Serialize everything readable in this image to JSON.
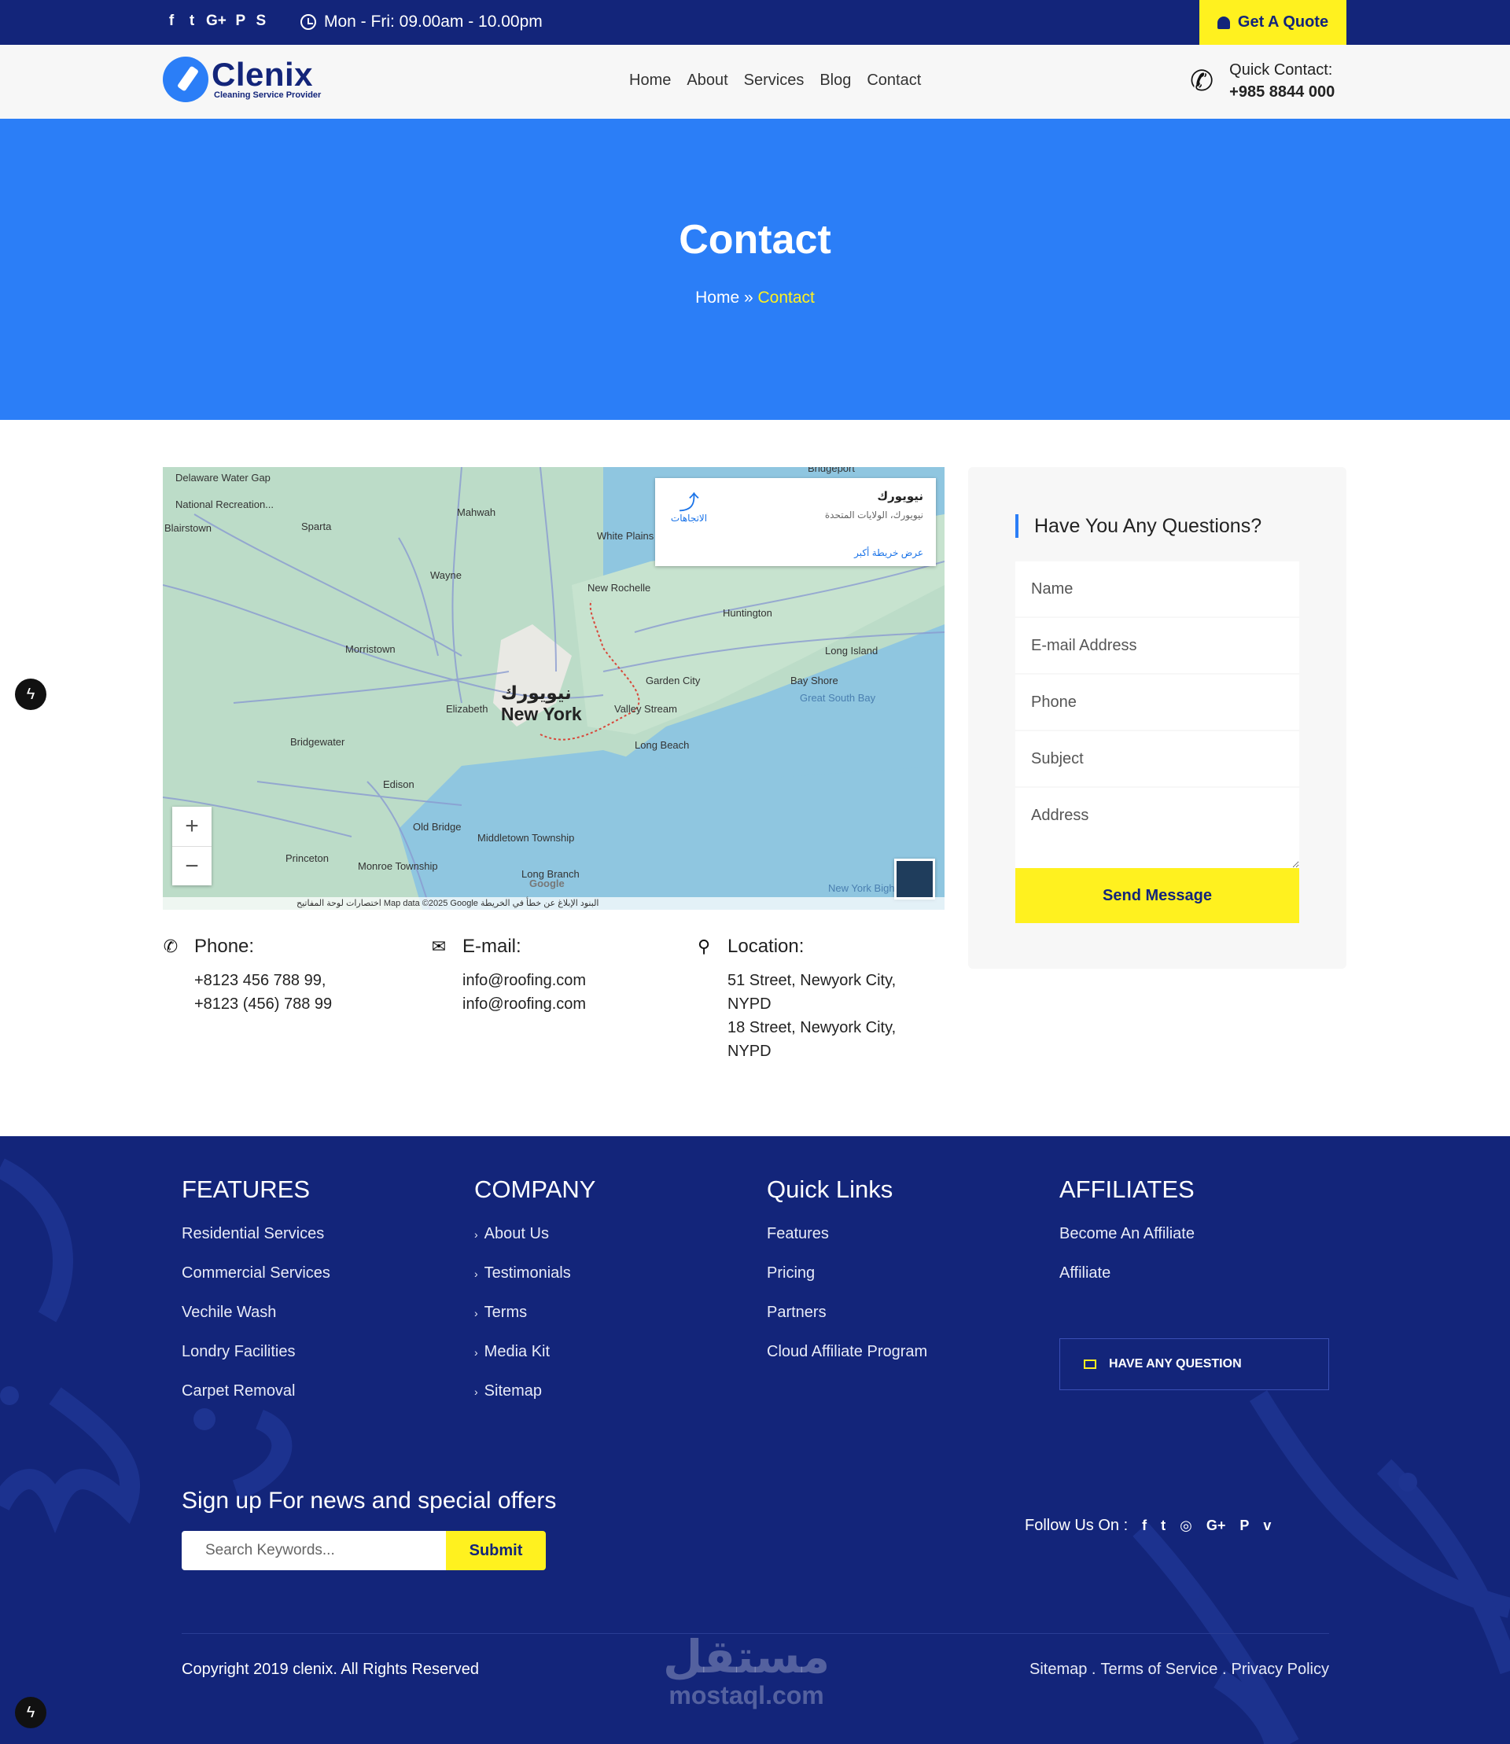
{
  "topbar": {
    "social": [
      "f",
      "t",
      "G+",
      "P",
      "S"
    ],
    "hours": "Mon - Fri: 09.00am - 10.00pm",
    "quote_label": "Get A Quote"
  },
  "header": {
    "logo_name": "Clenix",
    "logo_tagline": "Cleaning Service Provider",
    "nav": [
      "Home",
      "About",
      "Services",
      "Blog",
      "Contact"
    ],
    "quick_contact_label": "Quick Contact:",
    "quick_contact_number": "+985 8844 000"
  },
  "hero": {
    "title": "Contact",
    "breadcrumb_home": "Home",
    "breadcrumb_sep": "»",
    "breadcrumb_current": "Contact"
  },
  "map": {
    "card_title": "نيويورك",
    "card_subtitle": "نيويورك، الولايات المتحدة",
    "card_link": "عرض خريطة أكبر",
    "directions": "الاتجاهات",
    "city_ar": "نيويورك",
    "city_en": "New York",
    "footer_text": "اختصارات لوحة المفاتيح   Map data ©2025 Google   البنود   الإبلاغ عن خطأ في الخريطة",
    "labels": [
      {
        "text": "Delaware Water Gap"
      },
      {
        "text": "National Recreation..."
      },
      {
        "text": "Blairstown"
      },
      {
        "text": "Sparta"
      },
      {
        "text": "Mahwah"
      },
      {
        "text": "Wayne"
      },
      {
        "text": "White Plains"
      },
      {
        "text": "New Rochelle"
      },
      {
        "text": "Huntington"
      },
      {
        "text": "Morristown"
      },
      {
        "text": "Elizabeth"
      },
      {
        "text": "Bridgewater"
      },
      {
        "text": "Edison"
      },
      {
        "text": "Garden City"
      },
      {
        "text": "Valley Stream"
      },
      {
        "text": "Long Beach"
      },
      {
        "text": "Long Island"
      },
      {
        "text": "Bay Shore"
      },
      {
        "text": "Great South Bay"
      },
      {
        "text": "Old Bridge"
      },
      {
        "text": "Middletown Township"
      },
      {
        "text": "Princeton"
      },
      {
        "text": "Monroe Township"
      },
      {
        "text": "Long Branch"
      },
      {
        "text": "Google"
      },
      {
        "text": "Bridgeport"
      },
      {
        "text": "New York Bight"
      }
    ]
  },
  "contact_info": {
    "phone_title": "Phone:",
    "phone_lines": [
      "+8123 456 788 99,",
      "+8123 (456) 788 99"
    ],
    "email_title": "E-mail:",
    "email_lines": [
      "info@roofing.com",
      "info@roofing.com"
    ],
    "location_title": "Location:",
    "location_lines": [
      "51 Street, Newyork City,",
      "NYPD",
      "18 Street, Newyork City,",
      "NYPD"
    ]
  },
  "form": {
    "title": "Have You Any Questions?",
    "name_placeholder": "Name",
    "email_placeholder": "E-mail Address",
    "phone_placeholder": "Phone",
    "subject_placeholder": "Subject",
    "address_placeholder": "Address",
    "submit_label": "Send Message"
  },
  "footer": {
    "features": {
      "title": "FEATURES",
      "items": [
        "Residential Services",
        "Commercial Services",
        "Vechile Wash",
        "Londry Facilities",
        "Carpet Removal"
      ]
    },
    "company": {
      "title": "COMPANY",
      "items": [
        "About Us",
        "Testimonials",
        "Terms",
        "Media Kit",
        "Sitemap"
      ]
    },
    "quick_links": {
      "title": "Quick Links",
      "items": [
        "Features",
        "Pricing",
        "Partners",
        "Cloud Affiliate Program"
      ]
    },
    "affiliates": {
      "title": "AFFILIATES",
      "items": [
        "Become An Affiliate",
        "Affiliate"
      ],
      "button_label": "HAVE ANY QUESTION"
    },
    "signup_title": "Sign up For news and special offers",
    "signup_placeholder": "Search Keywords...",
    "signup_button": "Submit",
    "follow_label": "Follow Us On :",
    "follow_icons": [
      "f",
      "t",
      "◎",
      "G+",
      "P",
      "v"
    ],
    "copyright": "Copyright 2019 clenix. All Rights Reserved",
    "legal": [
      "Sitemap .",
      "Terms of Service .",
      "Privacy Policy"
    ],
    "watermark_ar": "مستقل",
    "watermark_en": "mostaql.com"
  },
  "colors": {
    "navy": "#13257a",
    "blue": "#2b7ef7",
    "yellow": "#fff11f"
  }
}
